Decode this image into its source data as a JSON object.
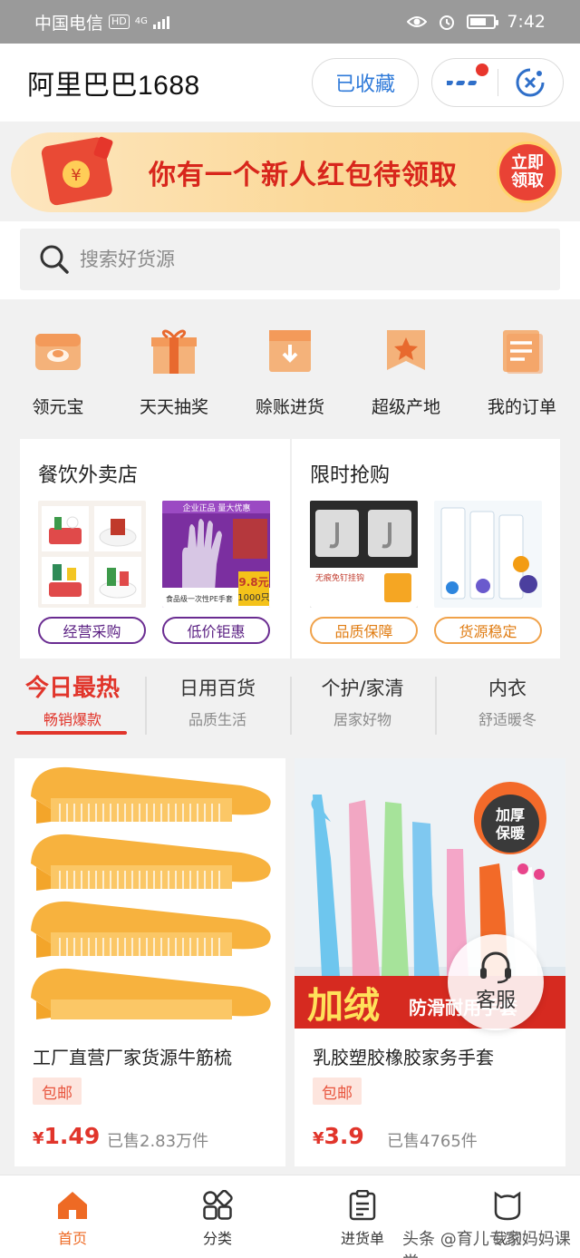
{
  "status_bar": {
    "carrier": "中国电信",
    "hd": "HD",
    "network": "4G",
    "time": "7:42"
  },
  "header": {
    "title": "阿里巴巴1688",
    "favorite_label": "已收藏"
  },
  "banner": {
    "text": "你有一个新人红包待领取",
    "claim_label": "立即领取",
    "currency_symbol": "¥"
  },
  "search": {
    "placeholder": "搜索好货源"
  },
  "quick_entries": [
    {
      "label": "领元宝",
      "icon": "ingot-icon"
    },
    {
      "label": "天天抽奖",
      "icon": "gift-box-icon"
    },
    {
      "label": "赊账进货",
      "icon": "download-box-icon"
    },
    {
      "label": "超级产地",
      "icon": "star-ribbon-icon"
    },
    {
      "label": "我的订单",
      "icon": "order-list-icon"
    }
  ],
  "promos": [
    {
      "title": "餐饮外卖店",
      "tags": [
        "经营采购",
        "低价钜惠"
      ],
      "image_texts": {
        "banner_top": "企业正品 量大优惠",
        "price": "9.8元",
        "qty": "1000只",
        "label": "食品级一次性PE手套"
      }
    },
    {
      "title": "限时抢购",
      "tags": [
        "品质保障",
        "货源稳定"
      ],
      "image_texts": {
        "hook_label": "无痕免钉挂钩"
      }
    }
  ],
  "category_tabs": [
    {
      "title": "今日最热",
      "subtitle": "畅销爆款",
      "active": true
    },
    {
      "title": "日用百货",
      "subtitle": "品质生活",
      "active": false
    },
    {
      "title": "个护/家清",
      "subtitle": "居家好物",
      "active": false
    },
    {
      "title": "内衣",
      "subtitle": "舒适暖冬",
      "active": false
    }
  ],
  "products": [
    {
      "name": "工厂直营厂家货源牛筋梳",
      "shipping": "包邮",
      "currency": "¥",
      "price": "1.49",
      "sold": "已售2.83万件"
    },
    {
      "name": "乳胶塑胶橡胶家务手套",
      "shipping": "包邮",
      "currency": "¥",
      "price": "3.9",
      "sold": "已售4765件",
      "image_badge": "加厚保暖",
      "image_caption": "加绒",
      "image_caption_small": "防滑耐用手套"
    }
  ],
  "customer_service": {
    "label": "客服"
  },
  "bottom_nav": [
    {
      "label": "首页",
      "icon": "home-icon",
      "active": true
    },
    {
      "label": "分类",
      "icon": "category-icon",
      "active": false
    },
    {
      "label": "进货单",
      "icon": "purchase-list-icon",
      "active": false
    },
    {
      "label": "我的",
      "icon": "profile-icon",
      "active": false
    }
  ],
  "watermark": "头条 @育儿专家妈妈课堂",
  "colors": {
    "accent_red": "#e1352b",
    "link_blue": "#2f7ad9",
    "nav_active": "#ee6a24",
    "tag_purple": "#5a1f82",
    "tag_orange": "#e07c12"
  }
}
